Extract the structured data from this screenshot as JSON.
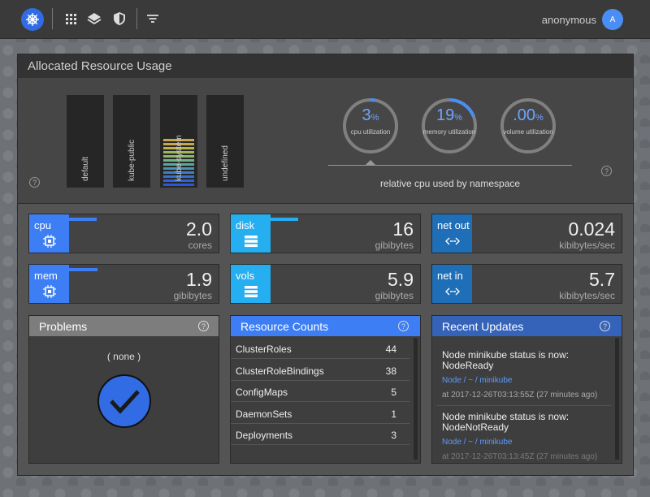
{
  "header": {
    "user_name": "anonymous",
    "avatar_initial": "A",
    "icons": [
      "kubernetes-logo",
      "grid-icon",
      "layers-icon",
      "shield-icon",
      "filter-icon"
    ]
  },
  "allocated": {
    "title": "Allocated Resource Usage",
    "namespaces": [
      "default",
      "kube-public",
      "kube-system",
      "undefined"
    ],
    "gauges": [
      {
        "value": "3",
        "unit": "%",
        "label": "cpu utilization",
        "fraction": 0.03
      },
      {
        "value": "19",
        "unit": "%",
        "label": "memory utilization",
        "fraction": 0.19
      },
      {
        "value": ".00",
        "unit": "%",
        "label": "volume utilization",
        "fraction": 0.0
      }
    ],
    "relative_caption": "relative cpu used by namespace",
    "help": "?"
  },
  "metrics": [
    {
      "name": "cpu",
      "value": "2.0",
      "unit": "cores",
      "fill": 0.03,
      "color": "#3d7ef5",
      "glyph": "chip-icon"
    },
    {
      "name": "disk",
      "value": "16",
      "unit": "gibibytes",
      "fill": 0.05,
      "color": "#25aef0",
      "glyph": "database-icon"
    },
    {
      "name": "net out",
      "value": "0.024",
      "unit": "kibibytes/sec",
      "fill": 0.0,
      "color": "#1f6fb8",
      "glyph": "network-icon"
    },
    {
      "name": "mem",
      "value": "1.9",
      "unit": "gibibytes",
      "fill": 0.19,
      "color": "#3d7ef5",
      "glyph": "chip-icon"
    },
    {
      "name": "vols",
      "value": "5.9",
      "unit": "gibibytes",
      "fill": 0.0,
      "color": "#25aef0",
      "glyph": "database-icon"
    },
    {
      "name": "net in",
      "value": "5.7",
      "unit": "kibibytes/sec",
      "fill": 0.0,
      "color": "#1f6fb8",
      "glyph": "network-icon"
    }
  ],
  "problems": {
    "title": "Problems",
    "text": "( none )"
  },
  "resource_counts": {
    "title": "Resource Counts",
    "rows": [
      {
        "label": "ClusterRoles",
        "count": "44"
      },
      {
        "label": "ClusterRoleBindings",
        "count": "38"
      },
      {
        "label": "ConfigMaps",
        "count": "5"
      },
      {
        "label": "DaemonSets",
        "count": "1"
      },
      {
        "label": "Deployments",
        "count": "3"
      }
    ]
  },
  "recent_updates": {
    "title": "Recent Updates",
    "items": [
      {
        "message": "Node minikube status is now: NodeReady",
        "link": "Node / ~ / minikube",
        "time": "at 2017-12-26T03:13:55Z (27 minutes ago)"
      },
      {
        "message": "Node minikube status is now: NodeNotReady",
        "link": "Node / ~ / minikube",
        "time": "at 2017-12-26T03:13:45Z (27 minutes ago)"
      }
    ]
  }
}
